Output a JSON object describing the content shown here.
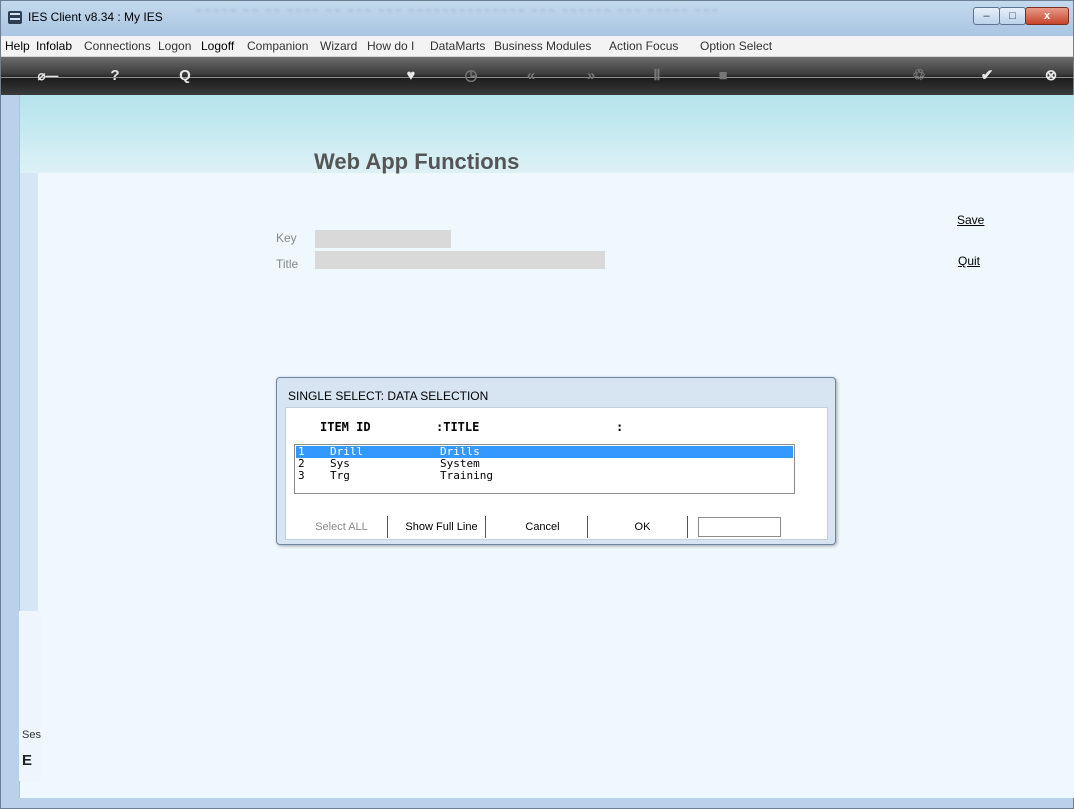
{
  "window": {
    "title": "IES Client v8.34 : My IES",
    "min_glyph": "–",
    "max_glyph": "□",
    "close_glyph": "x"
  },
  "menu": [
    {
      "label": "Help",
      "strong": true
    },
    {
      "label": "Infolab",
      "strong": true
    },
    {
      "label": "Connections",
      "strong": false
    },
    {
      "label": "Logon",
      "strong": false
    },
    {
      "label": "Logoff",
      "strong": true
    },
    {
      "label": "Companion",
      "strong": false
    },
    {
      "label": "Wizard",
      "strong": false
    },
    {
      "label": "How do I",
      "strong": false
    },
    {
      "label": "DataMarts",
      "strong": false
    },
    {
      "label": "Business Modules",
      "strong": false
    },
    {
      "label": "Action Focus",
      "strong": false
    },
    {
      "label": "Option Select",
      "strong": false
    }
  ],
  "toolbar": {
    "icons": [
      "key-icon",
      "help-icon",
      "search-icon",
      "heart-icon",
      "clock-icon",
      "rewind-icon",
      "forward-icon",
      "tool-icon",
      "square-icon",
      "recycle-icon",
      "check-icon",
      "close-icon"
    ],
    "glyphs": {
      "key": "⌀—",
      "help": "?",
      "search": "Q",
      "heart": "♥",
      "clock": "◷",
      "rewind": "«",
      "forward": "»",
      "tool": "Ⅱ",
      "square": "■",
      "recycle": "♲",
      "check": "✔",
      "close": "⊗"
    }
  },
  "page": {
    "title": "Web App Functions",
    "key_label": "Key",
    "title_label": "Title",
    "key_value": "",
    "title_value": "",
    "save_label": "Save",
    "quit_label": "Quit"
  },
  "session": {
    "label": "Ses",
    "glyph": "E"
  },
  "dialog": {
    "title": "SINGLE SELECT: DATA SELECTION",
    "col_item_id": "ITEM ID",
    "col_title": ":TITLE",
    "col_extra": ":",
    "rows": [
      {
        "num": "1",
        "id": "Drill",
        "title": "Drills",
        "selected": true
      },
      {
        "num": "2",
        "id": "Sys",
        "title": "System",
        "selected": false
      },
      {
        "num": "3",
        "id": "Trg",
        "title": "Training",
        "selected": false
      }
    ],
    "buttons": {
      "select_all": "Select ALL",
      "show_full_line": "Show Full Line",
      "cancel": "Cancel",
      "ok": "OK"
    },
    "search_value": ""
  }
}
